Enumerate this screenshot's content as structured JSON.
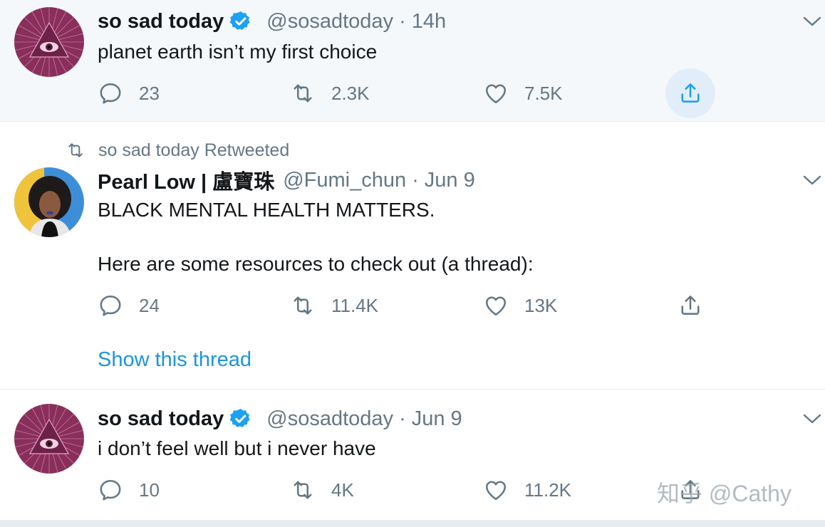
{
  "tweets": [
    {
      "name": "so sad today",
      "verified": true,
      "handle": "@sosadtoday",
      "separator": "·",
      "time": "14h",
      "lines": [
        "planet earth isn’t my first choice"
      ],
      "replies": "23",
      "retweets": "2.3K",
      "likes": "7.5K"
    },
    {
      "retweet_label": "so sad today Retweeted",
      "name": "Pearl Low | 盧寶珠",
      "verified": false,
      "handle": "@Fumi_chun",
      "separator": "·",
      "time": "Jun 9",
      "lines": [
        "BLACK MENTAL HEALTH MATTERS.",
        "Here are some resources to check out (a thread):"
      ],
      "replies": "24",
      "retweets": "11.4K",
      "likes": "13K",
      "show_thread": "Show this thread"
    },
    {
      "name": "so sad today",
      "verified": true,
      "handle": "@sosadtoday",
      "separator": "·",
      "time": "Jun 9",
      "lines": [
        "i don’t feel well but i never have"
      ],
      "replies": "10",
      "retweets": "4K",
      "likes": "11.2K"
    }
  ],
  "watermark": "知乎 @Cathy",
  "icons": {
    "reply": "reply-icon",
    "retweet": "retweet-icon",
    "like": "like-icon",
    "share": "share-icon",
    "caret": "chevron-down-icon",
    "verified": "verified-badge-icon"
  },
  "colors": {
    "text": "#14171a",
    "secondary": "#657786",
    "link": "#1b95e0",
    "verified": "#1da1f2",
    "hover_background": "#f5f8fa",
    "share_highlight": "#e1eef9"
  }
}
